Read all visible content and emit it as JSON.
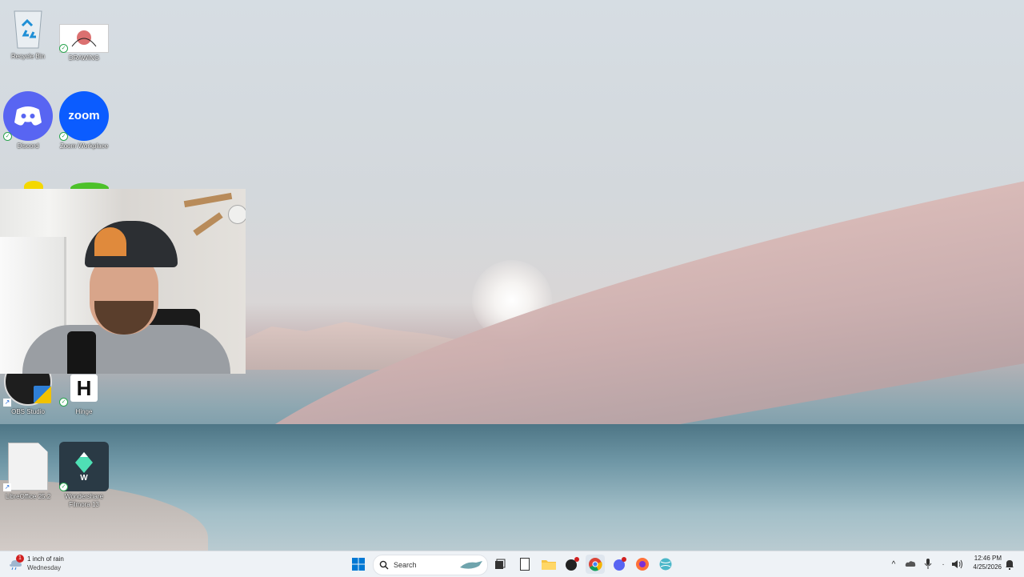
{
  "desktop": {
    "icons": [
      {
        "label": "Recycle Bin"
      },
      {
        "label": "DRAWING"
      },
      {
        "label": "Discord"
      },
      {
        "label": "Zoom Workplace"
      },
      {
        "label": "OBS Studio"
      },
      {
        "label": "Hinge"
      },
      {
        "label": "LibreOffice 25.2"
      },
      {
        "label": "Wondershare Filmora 13"
      }
    ],
    "zoom_logo_text": "zoom",
    "hinge_logo_text": "H"
  },
  "taskbar": {
    "weather": {
      "line1": "1 inch of rain",
      "line2": "Wednesday",
      "badge": "1"
    },
    "search_placeholder": "Search",
    "clock": {
      "time": "12:46 PM",
      "date": "4/25/2026"
    }
  },
  "colors": {
    "discord": "#5865F2",
    "zoom": "#0B5CFF",
    "taskbar_bg": "#eef2f6",
    "windows_blue": "#0078d4"
  }
}
